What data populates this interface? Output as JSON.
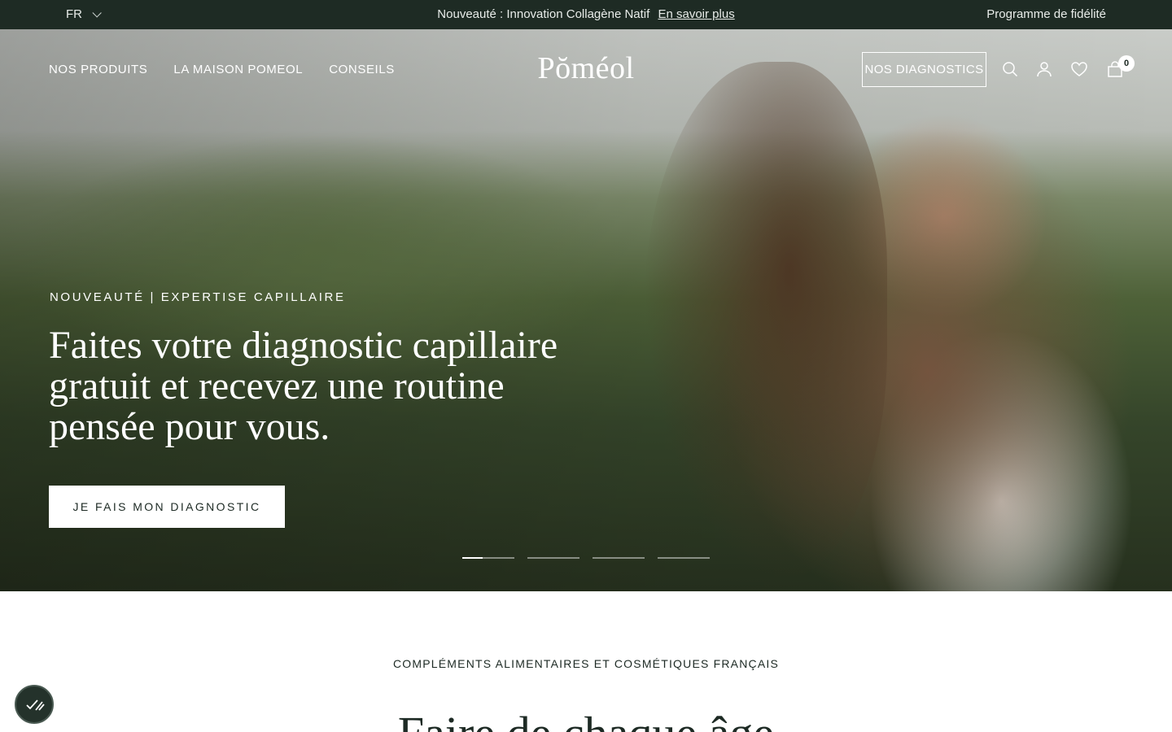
{
  "topbar": {
    "language": "FR",
    "announcement_text": "Nouveauté : Innovation Collagène Natif",
    "announcement_link": "En savoir plus",
    "loyalty_link": "Programme de fidélité"
  },
  "header": {
    "nav": [
      "NOS PRODUITS",
      "LA MAISON POMEOL",
      "CONSEILS"
    ],
    "logo": "Pŏméol",
    "diagnostics_button": "NOS DIAGNOSTICS",
    "icons": [
      "search-icon",
      "account-icon",
      "heart-icon",
      "cart-icon"
    ],
    "cart_count": "0"
  },
  "hero": {
    "eyebrow": "NOUVEAUTÉ | EXPERTISE CAPILLAIRE",
    "headline": "Faites votre diagnostic capillaire gratuit et recevez une routine pensée pour vous.",
    "cta": "JE FAIS MON DIAGNOSTIC",
    "slides_total": 4,
    "active_slide": 1
  },
  "section": {
    "kicker": "COMPLÉMENTS ALIMENTAIRES ET COSMÉTIQUES FRANÇAIS",
    "title": "Faire de chaque âge"
  },
  "colors": {
    "topbar_bg": "#1e2b24",
    "text_dark": "#1d2a24",
    "white": "#ffffff"
  }
}
